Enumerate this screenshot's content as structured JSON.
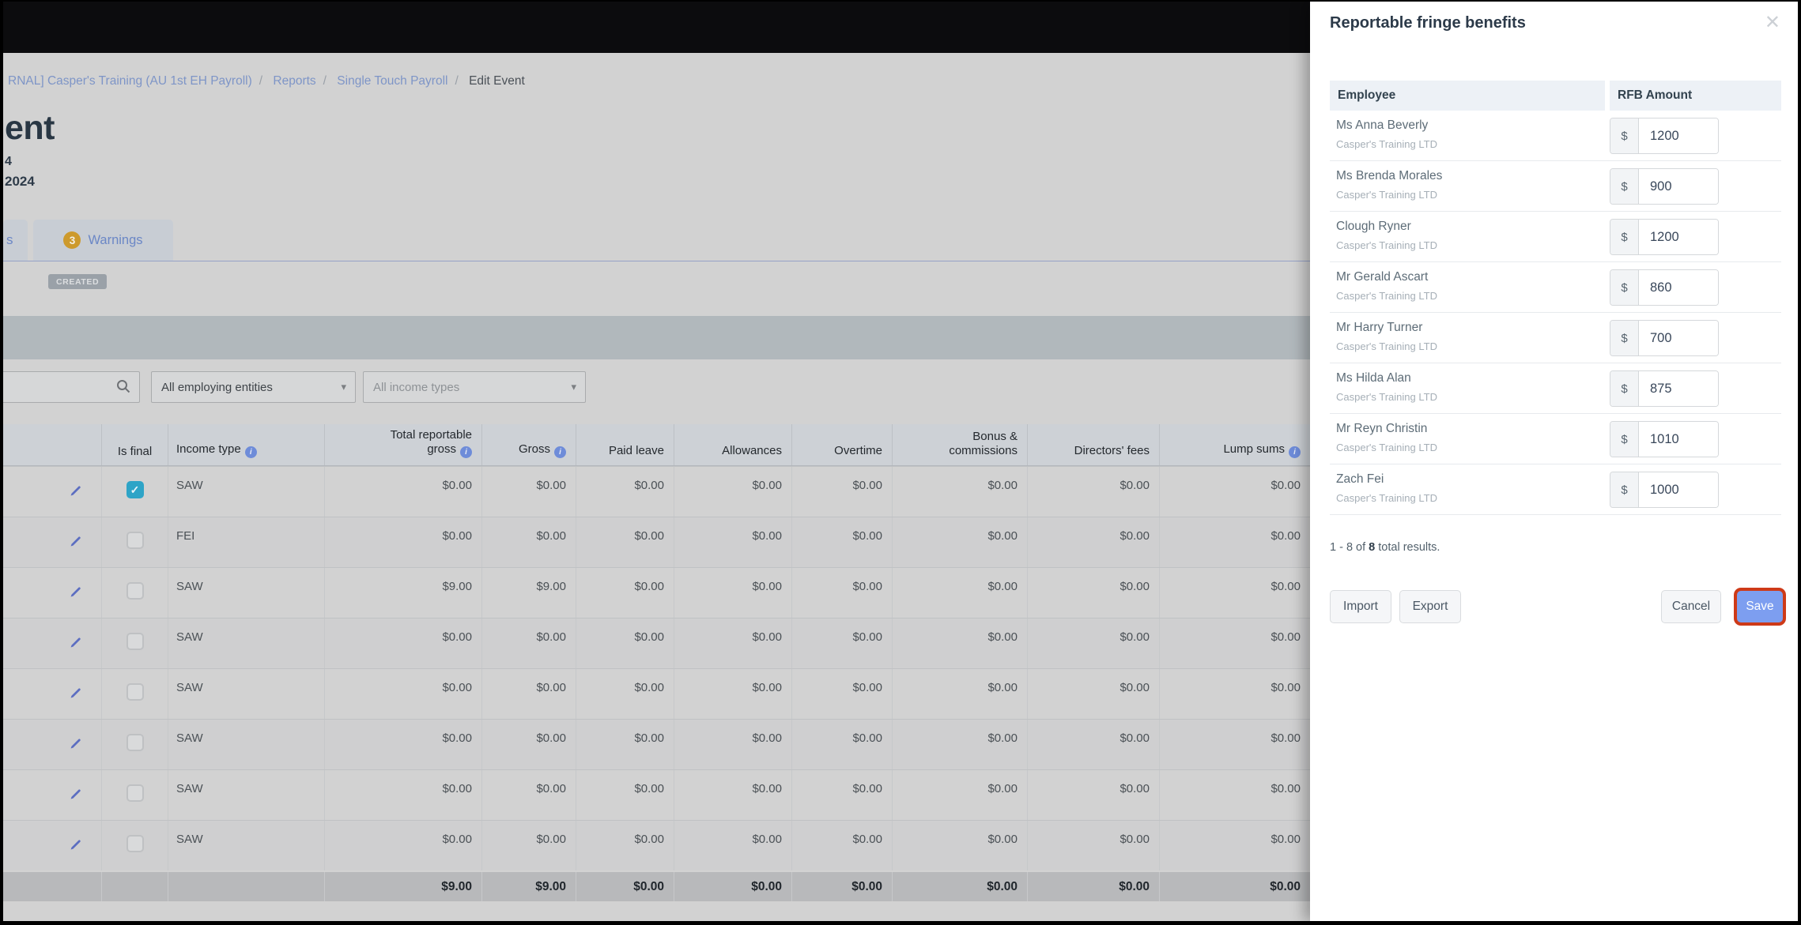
{
  "icons": {
    "check": "✓",
    "close": "✕",
    "caret": "▾",
    "info": "i"
  },
  "colors": {
    "save_button": "#7d9ef0",
    "highlight_ring": "#ce3a18",
    "checkbox_checked": "#2ea4c7",
    "warning_badge": "#cd9a2d",
    "link_blue": "#7e95c7"
  },
  "page": {
    "breadcrumb": {
      "separator": "/",
      "items": [
        {
          "label": "RNAL] Casper's Training (AU 1st EH Payroll)",
          "current": false
        },
        {
          "label": "Reports",
          "current": false
        },
        {
          "label": "Single Touch Payroll",
          "current": false
        },
        {
          "label": "Edit Event",
          "current": true
        }
      ]
    },
    "title_fragment": "ent",
    "subtitle_fragment_1": "4",
    "subtitle_fragment_2": "2024",
    "tabs": {
      "partial_label": "s",
      "warnings_count": "3",
      "warnings_label": "Warnings"
    },
    "status_badge": "CREATED",
    "filters": {
      "search_value": "",
      "entities_dropdown": "All employing entities",
      "income_types_dropdown": "All income types"
    },
    "table": {
      "headers": {
        "is_final": "Is final",
        "income_type": "Income type",
        "total_reportable_gross": "Total reportable gross",
        "gross": "Gross",
        "paid_leave": "Paid leave",
        "allowances": "Allowances",
        "overtime": "Overtime",
        "bonus_commissions": "Bonus & commissions",
        "directors_fees": "Directors' fees",
        "lump_sums": "Lump sums"
      },
      "rows": [
        {
          "final": true,
          "income_type": "SAW",
          "values": [
            "$0.00",
            "$0.00",
            "$0.00",
            "$0.00",
            "$0.00",
            "$0.00",
            "$0.00",
            "$0.00"
          ]
        },
        {
          "final": false,
          "income_type": "FEI",
          "values": [
            "$0.00",
            "$0.00",
            "$0.00",
            "$0.00",
            "$0.00",
            "$0.00",
            "$0.00",
            "$0.00"
          ]
        },
        {
          "final": false,
          "income_type": "SAW",
          "values": [
            "$9.00",
            "$9.00",
            "$0.00",
            "$0.00",
            "$0.00",
            "$0.00",
            "$0.00",
            "$0.00"
          ]
        },
        {
          "final": false,
          "income_type": "SAW",
          "values": [
            "$0.00",
            "$0.00",
            "$0.00",
            "$0.00",
            "$0.00",
            "$0.00",
            "$0.00",
            "$0.00"
          ]
        },
        {
          "final": false,
          "income_type": "SAW",
          "values": [
            "$0.00",
            "$0.00",
            "$0.00",
            "$0.00",
            "$0.00",
            "$0.00",
            "$0.00",
            "$0.00"
          ]
        },
        {
          "final": false,
          "income_type": "SAW",
          "values": [
            "$0.00",
            "$0.00",
            "$0.00",
            "$0.00",
            "$0.00",
            "$0.00",
            "$0.00",
            "$0.00"
          ]
        },
        {
          "final": false,
          "income_type": "SAW",
          "values": [
            "$0.00",
            "$0.00",
            "$0.00",
            "$0.00",
            "$0.00",
            "$0.00",
            "$0.00",
            "$0.00"
          ]
        },
        {
          "final": false,
          "income_type": "SAW",
          "values": [
            "$0.00",
            "$0.00",
            "$0.00",
            "$0.00",
            "$0.00",
            "$0.00",
            "$0.00",
            "$0.00"
          ]
        }
      ],
      "totals": [
        "$9.00",
        "$9.00",
        "$0.00",
        "$0.00",
        "$0.00",
        "$0.00",
        "$0.00",
        "$0.00"
      ]
    }
  },
  "drawer": {
    "title": "Reportable fringe benefits",
    "table": {
      "employee_header": "Employee",
      "amount_header": "RFB Amount",
      "currency_symbol": "$",
      "rows": [
        {
          "name": "Ms Anna Beverly",
          "company": "Casper's Training LTD",
          "amount": "1200"
        },
        {
          "name": "Ms Brenda Morales",
          "company": "Casper's Training LTD",
          "amount": "900"
        },
        {
          "name": "Clough Ryner",
          "company": "Casper's Training LTD",
          "amount": "1200"
        },
        {
          "name": "Mr Gerald Ascart",
          "company": "Casper's Training LTD",
          "amount": "860"
        },
        {
          "name": "Mr Harry Turner",
          "company": "Casper's Training LTD",
          "amount": "700"
        },
        {
          "name": "Ms Hilda Alan",
          "company": "Casper's Training LTD",
          "amount": "875"
        },
        {
          "name": "Mr Reyn Christin",
          "company": "Casper's Training LTD",
          "amount": "1010"
        },
        {
          "name": "Zach Fei",
          "company": "Casper's Training LTD",
          "amount": "1000"
        }
      ]
    },
    "pagination": {
      "range": "1 - 8 of ",
      "total": "8",
      "suffix": " total results."
    },
    "buttons": {
      "import": "Import",
      "export": "Export",
      "cancel": "Cancel",
      "save": "Save"
    }
  }
}
